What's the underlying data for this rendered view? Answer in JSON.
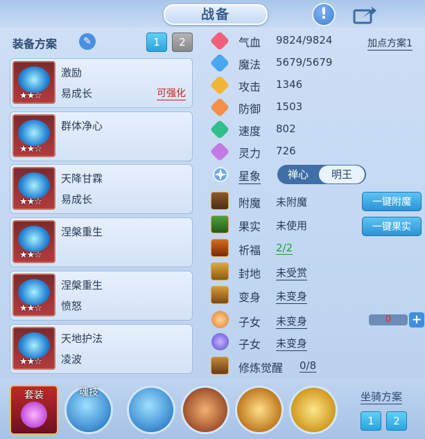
{
  "header": {
    "title": "战备"
  },
  "left": {
    "scheme_title": "装备方案",
    "scheme_buttons": [
      "1",
      "2"
    ],
    "cards": [
      {
        "name": "激励",
        "sub": "易成长",
        "tag": "可强化",
        "stars": "★★☆"
      },
      {
        "name": "群体净心",
        "sub": "",
        "tag": "",
        "stars": "★★☆"
      },
      {
        "name": "天降甘霖",
        "sub": "易成长",
        "tag": "",
        "stars": "★★☆"
      },
      {
        "name": "涅槃重生",
        "sub": "",
        "tag": "",
        "stars": "★★☆"
      },
      {
        "name": "涅槃重生",
        "sub": "愤怒",
        "tag": "",
        "stars": "★★☆"
      },
      {
        "name": "天地护法",
        "sub": "凌波",
        "tag": "",
        "stars": "★★☆"
      }
    ]
  },
  "stats": {
    "plan_link": "加点方案1",
    "items": [
      {
        "label": "气血",
        "value": "9824/9824",
        "color": "#f0607a"
      },
      {
        "label": "魔法",
        "value": "5679/5679",
        "color": "#4fa6f0"
      },
      {
        "label": "攻击",
        "value": "1346",
        "color": "#f2b536"
      },
      {
        "label": "防御",
        "value": "1503",
        "color": "#f2904a"
      },
      {
        "label": "速度",
        "value": "802",
        "color": "#2fc08c"
      },
      {
        "label": "灵力",
        "value": "726",
        "color": "#c27ae6"
      }
    ],
    "xingxiang": {
      "label": "星象",
      "opt_a": "禅心",
      "opt_b": "明王"
    }
  },
  "subs": {
    "items": [
      {
        "label": "附魔",
        "value": "未附魔"
      },
      {
        "label": "果实",
        "value": "未使用"
      },
      {
        "label": "祈福",
        "value": "2/2"
      },
      {
        "label": "封地",
        "value": "未受赏"
      },
      {
        "label": "变身",
        "value": "未变身"
      },
      {
        "label": "子女",
        "value": "未变身"
      },
      {
        "label": "子女",
        "value": "未变身"
      },
      {
        "label": "修炼觉醒",
        "value": "0/8"
      }
    ],
    "btn_enchant": "一键附魔",
    "btn_fruit": "一键果实",
    "child_counter": "0"
  },
  "bottom": {
    "tao_label": "套装",
    "soul_label": "魂技",
    "mount_title": "坐骑方案",
    "mount_buttons": [
      "1",
      "2"
    ]
  }
}
